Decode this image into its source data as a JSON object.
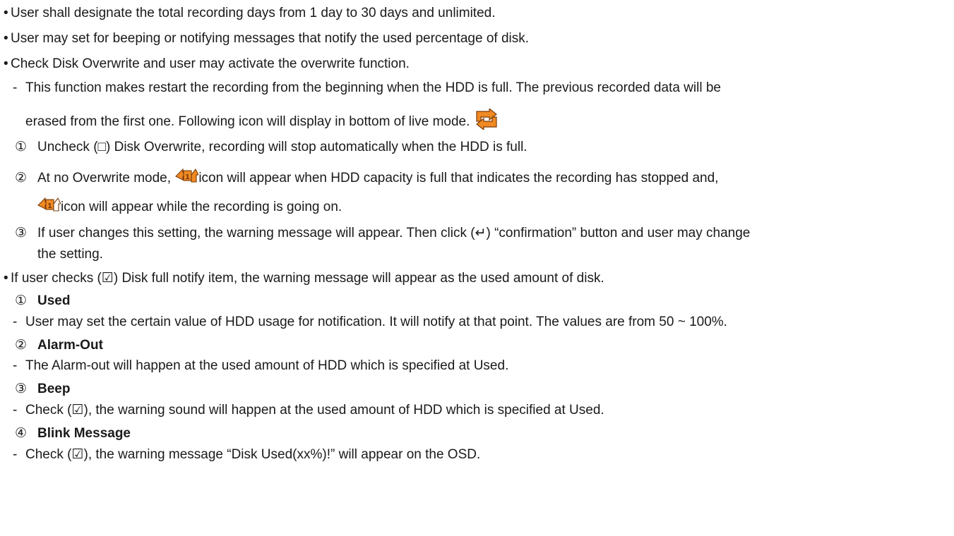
{
  "bullet_glyph": "•",
  "dash_glyph": "-",
  "items": {
    "b1": "User shall designate the total recording days from 1 day to 30 days and unlimited.",
    "b2": "User may set for beeping or notifying messages that notify the used percentage of disk.",
    "b3": "Check Disk Overwrite and user may activate the overwrite function.",
    "d1_line1": "This function makes restart the recording from the beginning when the HDD is full. The previous recorded data will be",
    "d1_line2": "erased from the first one. Following icon will display in bottom of live mode.",
    "n1_mark": "①",
    "n1_text": "Uncheck (□) Disk Overwrite, recording will stop automatically when the HDD is full.",
    "n2_mark": "②",
    "n2_pre": "At no Overwrite mode,",
    "n2_post": "icon will appear when HDD capacity is full that indicates the recording has stopped and,",
    "n2_line2": "icon will appear while the recording is going on.",
    "n3_mark": "③",
    "n3_line1": "If user changes this setting, the warning message will appear. Then click (↵) “confirmation” button and user may change",
    "n3_line2": "the setting.",
    "b4": "If user checks (☑) Disk full notify item, the warning message will appear as the used amount of disk.",
    "s1_mark": "①",
    "s1_title": "Used",
    "s1_desc": "User may set the certain value of HDD usage for notification. It will notify at that point. The values are from 50 ~ 100%.",
    "s2_mark": "②",
    "s2_title": "Alarm-Out",
    "s2_desc": "The Alarm-out will happen at the used amount of HDD which is specified at Used.",
    "s3_mark": "③",
    "s3_title": "Beep",
    "s3_desc": "Check (☑), the warning sound will happen at the used amount of HDD which is specified at Used.",
    "s4_mark": "④",
    "s4_title": "Blink Message",
    "s4_desc": "Check (☑), the warning message “Disk Used(xx%)!” will appear on the OSD."
  },
  "icons": {
    "overwrite_icon": "overwrite-icon",
    "no_overwrite_full_icon": "no-overwrite-full-icon",
    "no_overwrite_recording_icon": "no-overwrite-recording-icon"
  },
  "colors": {
    "icon_orange": "#f08a24",
    "icon_dark": "#7a3b08",
    "text": "#1a1a1a"
  }
}
